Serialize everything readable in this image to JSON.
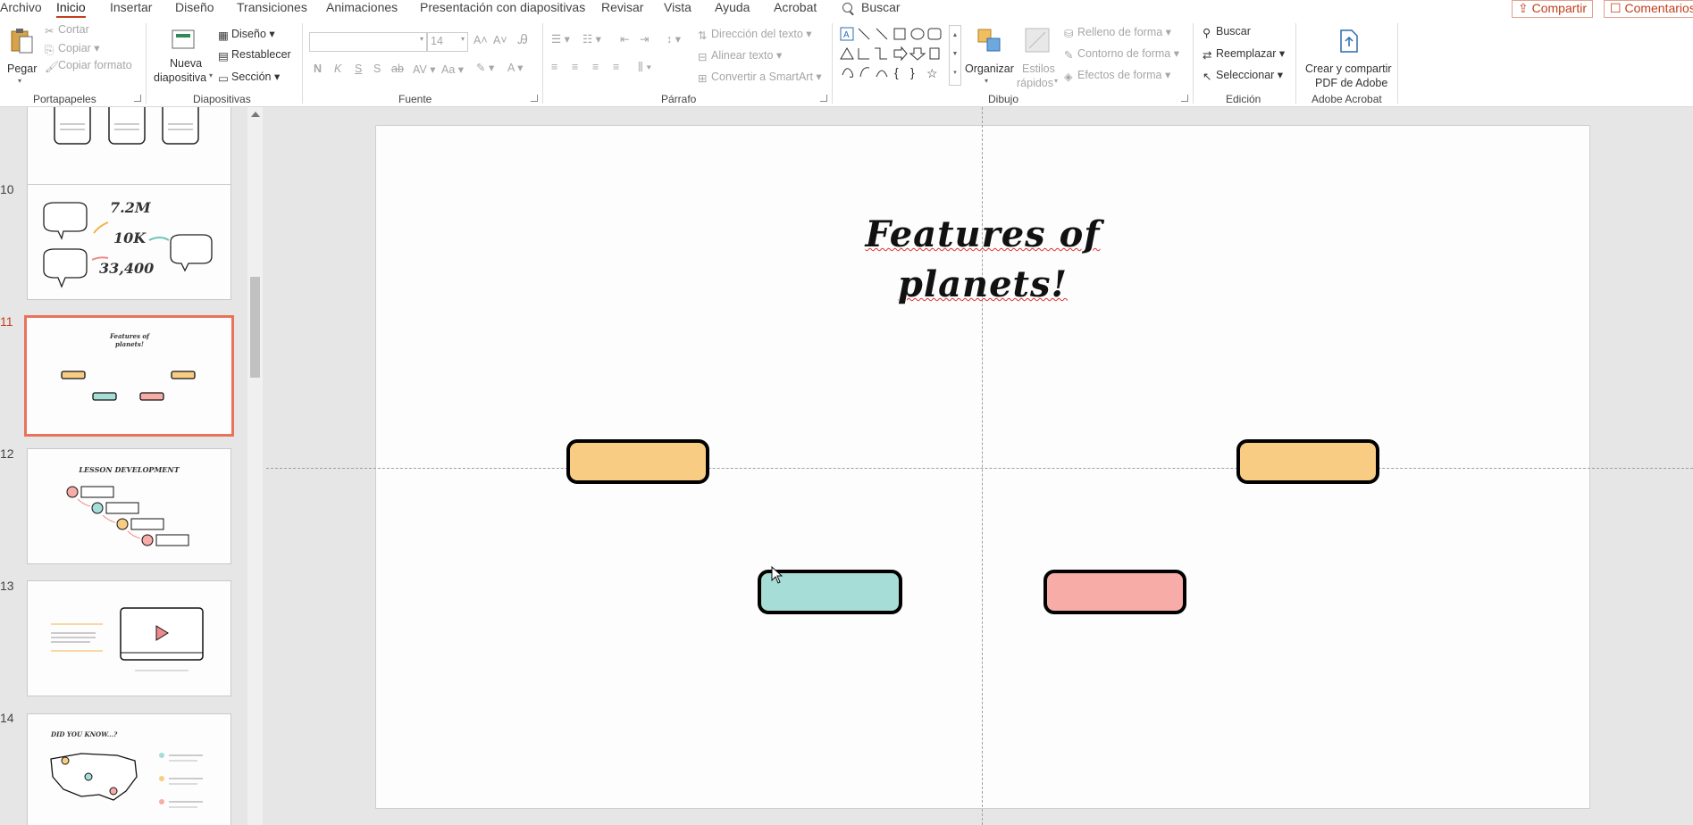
{
  "menu": {
    "tabs": [
      "Archivo",
      "Inicio",
      "Insertar",
      "Diseño",
      "Transiciones",
      "Animaciones",
      "Presentación con diapositivas",
      "Revisar",
      "Vista",
      "Ayuda",
      "Acrobat"
    ],
    "search": "Buscar",
    "share": "Compartir",
    "comments": "Comentarios"
  },
  "ribbon": {
    "clipboard": {
      "paste": "Pegar",
      "cut": "Cortar",
      "copy": "Copiar",
      "format_painter": "Copiar formato",
      "label": "Portapapeles"
    },
    "slides": {
      "new_slide_1": "Nueva",
      "new_slide_2": "diapositiva",
      "layout": "Diseño",
      "reset": "Restablecer",
      "section": "Sección",
      "label": "Diapositivas"
    },
    "font": {
      "size": "14",
      "label": "Fuente"
    },
    "paragraph": {
      "text_direction": "Dirección del texto",
      "align_text": "Alinear texto",
      "smartart": "Convertir a SmartArt",
      "label": "Párrafo"
    },
    "drawing": {
      "arrange": "Organizar",
      "quick_styles_1": "Estilos",
      "quick_styles_2": "rápidos",
      "fill": "Relleno de forma",
      "outline": "Contorno de forma",
      "effects": "Efectos de forma",
      "label": "Dibujo"
    },
    "editing": {
      "find": "Buscar",
      "replace": "Reemplazar",
      "select": "Seleccionar",
      "label": "Edición"
    },
    "acrobat": {
      "create_1": "Crear y compartir",
      "create_2": "PDF de Adobe",
      "label": "Adobe Acrobat"
    }
  },
  "thumbnails": {
    "numbers": [
      "10",
      "11",
      "12",
      "13",
      "14"
    ],
    "slide10": {
      "n1": "7.2M",
      "n2": "10K",
      "n3": "33,400"
    },
    "slide11": {
      "title": "Features of planets!"
    },
    "slide12": {
      "title": "LESSON DEVELOPMENT"
    },
    "slide14": {
      "title": "DID YOU KNOW...?"
    }
  },
  "slide": {
    "title_line1": "Features of",
    "title_line2": "planets!"
  },
  "colors": {
    "accent": "#c43e1c",
    "yellow": "#f8cd83",
    "teal": "#a6ddd7",
    "pink": "#f8aca7"
  }
}
